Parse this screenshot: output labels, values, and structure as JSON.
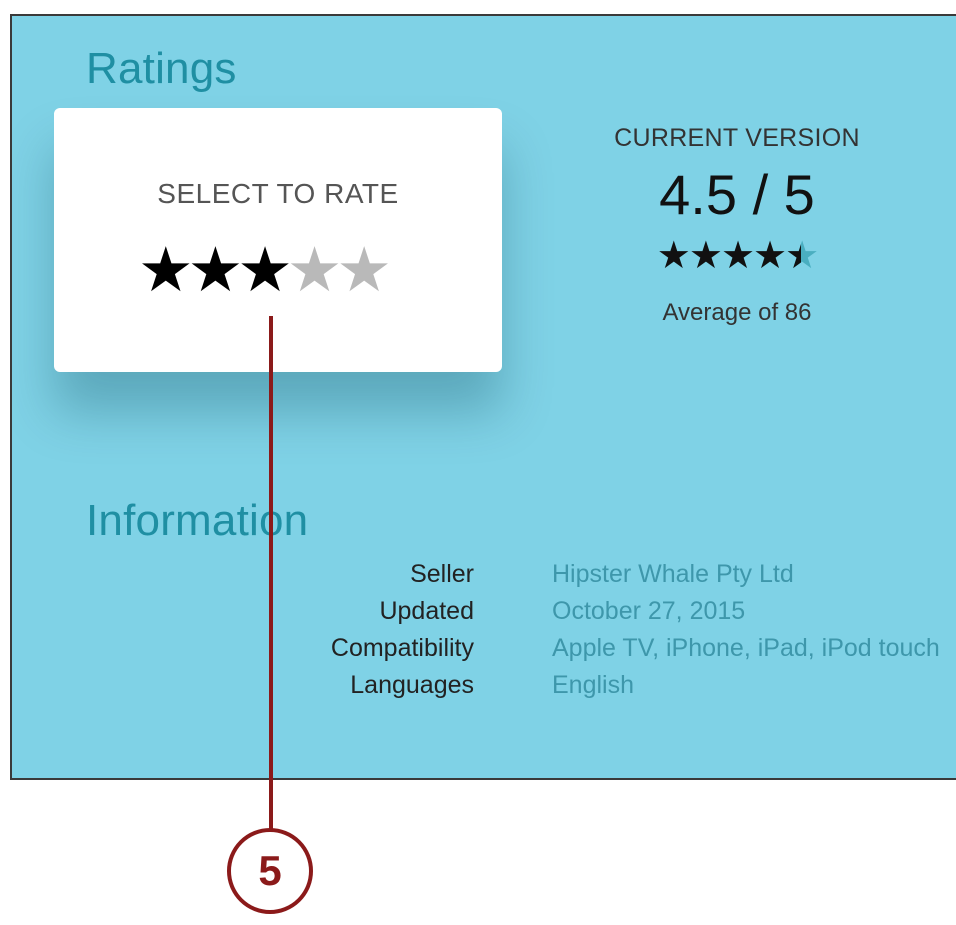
{
  "ratings": {
    "title": "Ratings",
    "rate_card": {
      "label": "SELECT TO RATE",
      "rating": 3,
      "max": 5
    },
    "current": {
      "label": "CURRENT VERSION",
      "score": "4.5 / 5",
      "stars": 4.5,
      "average": "Average of 86"
    }
  },
  "information": {
    "title": "Information",
    "rows": [
      {
        "key": "Seller",
        "value": "Hipster Whale Pty Ltd"
      },
      {
        "key": "Updated",
        "value": "October 27, 2015"
      },
      {
        "key": "Compatibility",
        "value": "Apple TV, iPhone, iPad, iPod touch"
      },
      {
        "key": "Languages",
        "value": "English"
      }
    ]
  },
  "callout": {
    "number": "5"
  }
}
